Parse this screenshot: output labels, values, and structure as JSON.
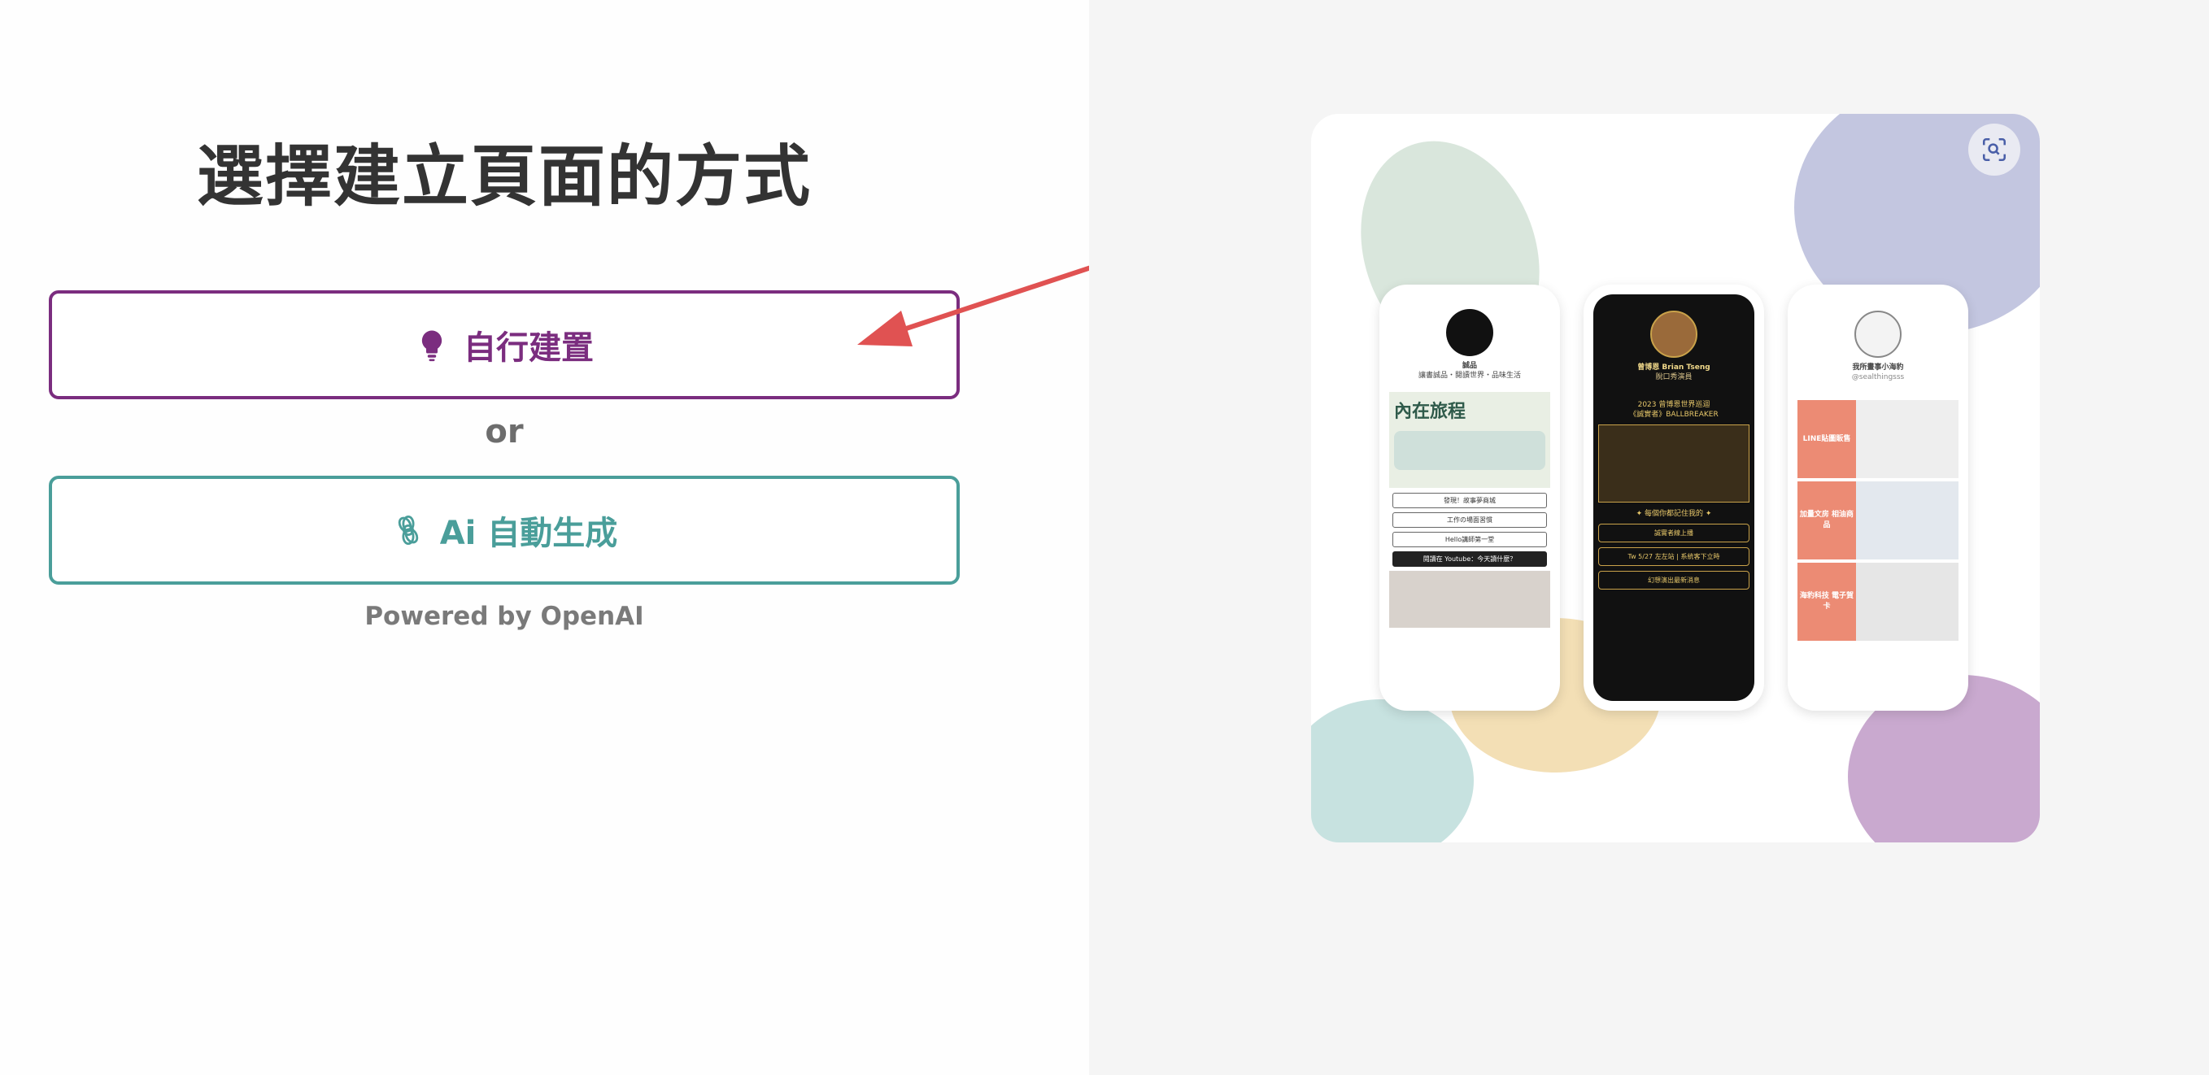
{
  "page": {
    "title": "選擇建立頁面的方式",
    "or_label": "or",
    "powered_by": "Powered by OpenAI"
  },
  "options": {
    "manual": {
      "label": "自行建置",
      "icon": "lightbulb-icon",
      "color": "#7b2d7f"
    },
    "ai": {
      "label": "Ai 自動生成",
      "icon": "openai-icon",
      "color": "#4a9e9a"
    }
  },
  "annotation": {
    "arrow_color": "#e05252"
  },
  "preview": {
    "zoom_icon": "scan-zoom-icon",
    "phones": [
      {
        "name": "誠品",
        "subtitle": "讓書誠品・閱讀世界・品味生活",
        "banner_title": "內在旅程",
        "buttons": [
          "發現！故事夢商城",
          "工作の場面習慣",
          "Hello講師第一堂"
        ],
        "video_bar": "閱讀在 Youtube：今天讀什麼？"
      },
      {
        "name": "曾博恩 Brian Tseng",
        "subtitle": "脫口秀演員",
        "banner_title": "2023 曾博恩世界巡迴",
        "banner_subtitle": "《誠實者》BALLBREAKER",
        "buttons": [
          "✦ 每個你都記住我的 ✦",
          "誠實者線上播",
          "Tw 5/27 左左站 | 系統客下立時",
          "幻想演出最新消息"
        ]
      },
      {
        "name": "我所畫事小海豹",
        "subtitle": "@sealthingsss",
        "tiles": [
          "LINE貼圖販售",
          "加量文房\n相油商品",
          "海豹科技\n電子賀卡"
        ]
      }
    ]
  }
}
